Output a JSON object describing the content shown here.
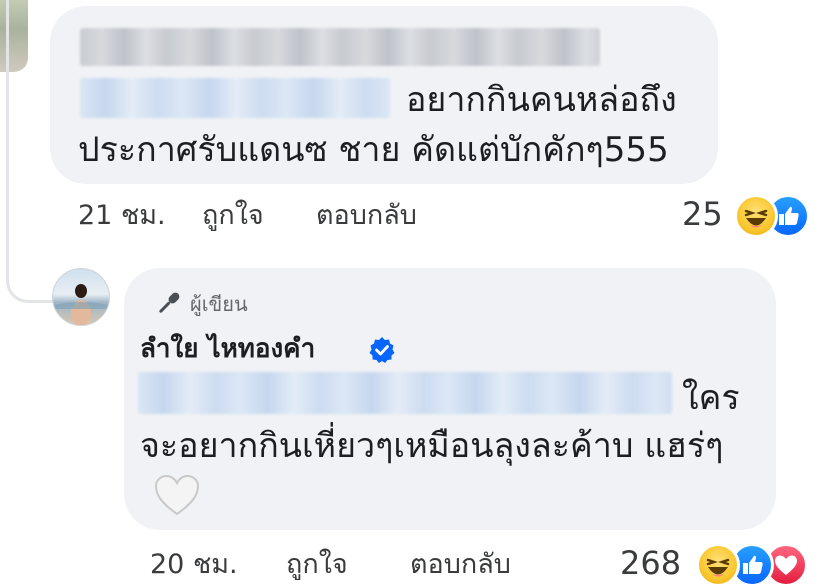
{
  "comment1": {
    "text_line1_tail": "อยากกินคนหล่อถึง",
    "text_line2": "ประกาศรับแดนซ ชาย  คัดแต่บักคักๆ555",
    "time": "21 ชม.",
    "like_label": "ถูกใจ",
    "reply_label": "ตอบกลับ",
    "reaction_count": "25",
    "reactions": [
      "haha-icon",
      "like-icon"
    ]
  },
  "reply": {
    "author_tag": "ผู้เขียน",
    "author_name": "ลำใย ไหทองคำ",
    "verified": true,
    "text_line1_tail": "ใคร",
    "text_line2": "จะอยากกินเหี่ยวๆเหมือนลุงละค้าบ แฮร่ๆ",
    "emoji": "🤍",
    "time": "20 ชม.",
    "like_label": "ถูกใจ",
    "reply_label": "ตอบกลับ",
    "reaction_count": "268",
    "reactions": [
      "haha-icon",
      "like-icon",
      "love-icon"
    ]
  },
  "colors": {
    "bubble": "#f0f2f5",
    "verified": "#0866ff",
    "text": "#1c1e21",
    "meta": "#65676b"
  }
}
